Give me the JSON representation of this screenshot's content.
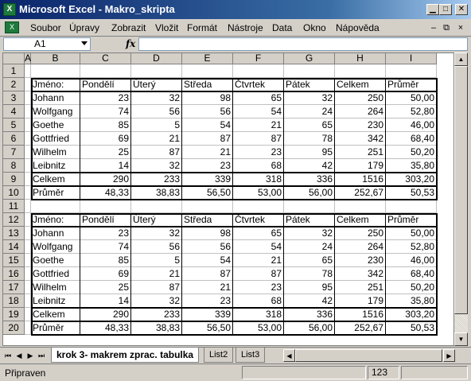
{
  "window": {
    "title": "Microsoft Excel - Makro_skripta",
    "app_icon": "excel-icon",
    "caption_buttons": [
      "minimize",
      "maximize",
      "close"
    ]
  },
  "menu": {
    "items": [
      "Soubor",
      "Úpravy",
      "Zobrazit",
      "Vložit",
      "Formát",
      "Nástroje",
      "Data",
      "Okno",
      "Nápověda"
    ],
    "mdi_buttons": [
      "minimize",
      "restore",
      "close"
    ]
  },
  "formula_bar": {
    "name_box": "A1",
    "fx_label": "fx",
    "formula": ""
  },
  "sheet": {
    "columns": [
      "A",
      "B",
      "C",
      "D",
      "E",
      "F",
      "G",
      "H",
      "I"
    ],
    "rows": [
      "1",
      "2",
      "3",
      "4",
      "5",
      "6",
      "7",
      "8",
      "9",
      "10",
      "11",
      "12",
      "13",
      "14",
      "15",
      "16",
      "17",
      "18",
      "19",
      "20"
    ],
    "table1": {
      "header": [
        "Jméno:",
        "Pondělí",
        "Úterý",
        "Středa",
        "Čtvrtek",
        "Pátek",
        "Celkem",
        "Průměr"
      ],
      "rows": [
        [
          "Johann",
          "23",
          "32",
          "98",
          "65",
          "32",
          "250",
          "50,00"
        ],
        [
          "Wolfgang",
          "74",
          "56",
          "56",
          "54",
          "24",
          "264",
          "52,80"
        ],
        [
          "Goethe",
          "85",
          "5",
          "54",
          "21",
          "65",
          "230",
          "46,00"
        ],
        [
          "Gottfried",
          "69",
          "21",
          "87",
          "87",
          "78",
          "342",
          "68,40"
        ],
        [
          "Wilhelm",
          "25",
          "87",
          "21",
          "23",
          "95",
          "251",
          "50,20"
        ],
        [
          "Leibnitz",
          "14",
          "32",
          "23",
          "68",
          "42",
          "179",
          "35,80"
        ],
        [
          "Celkem",
          "290",
          "233",
          "339",
          "318",
          "336",
          "1516",
          "303,20"
        ],
        [
          "Průměr",
          "48,33",
          "38,83",
          "56,50",
          "53,00",
          "56,00",
          "252,67",
          "50,53"
        ]
      ]
    },
    "table2": {
      "header": [
        "Jméno:",
        "Pondělí",
        "Úterý",
        "Středa",
        "Čtvrtek",
        "Pátek",
        "Celkem",
        "Průměr"
      ],
      "rows": [
        [
          "Johann",
          "23",
          "32",
          "98",
          "65",
          "32",
          "250",
          "50,00"
        ],
        [
          "Wolfgang",
          "74",
          "56",
          "56",
          "54",
          "24",
          "264",
          "52,80"
        ],
        [
          "Goethe",
          "85",
          "5",
          "54",
          "21",
          "65",
          "230",
          "46,00"
        ],
        [
          "Gottfried",
          "69",
          "21",
          "87",
          "87",
          "78",
          "342",
          "68,40"
        ],
        [
          "Wilhelm",
          "25",
          "87",
          "21",
          "23",
          "95",
          "251",
          "50,20"
        ],
        [
          "Leibnitz",
          "14",
          "32",
          "23",
          "68",
          "42",
          "179",
          "35,80"
        ],
        [
          "Celkem",
          "290",
          "233",
          "339",
          "318",
          "336",
          "1516",
          "303,20"
        ],
        [
          "Průměr",
          "48,33",
          "38,83",
          "56,50",
          "53,00",
          "56,00",
          "252,67",
          "50,53"
        ]
      ]
    }
  },
  "tabs": {
    "items": [
      "krok 3- makrem zprac. tabulka",
      "List2",
      "List3"
    ],
    "active": "krok 3- makrem zprac. tabulka"
  },
  "status": {
    "text": "Připraven",
    "indicator": "123"
  }
}
